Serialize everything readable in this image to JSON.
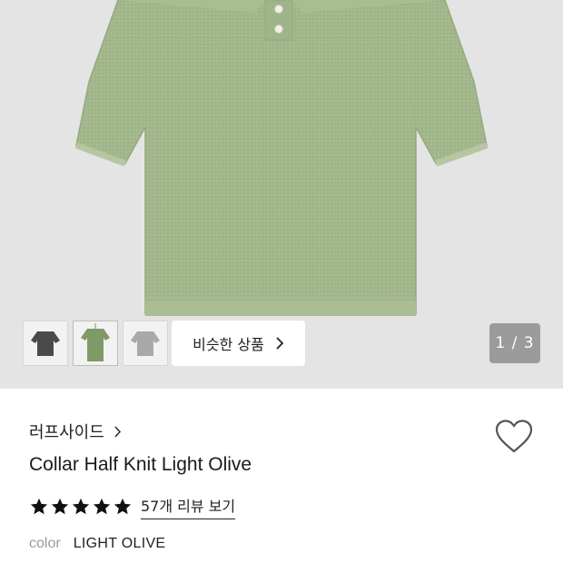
{
  "gallery": {
    "thumbnails": [
      {
        "alt": "charcoal",
        "color": "#4a4a4a"
      },
      {
        "alt": "light olive",
        "color": "#7f9a67"
      },
      {
        "alt": "gray",
        "color": "#a8aaa8"
      }
    ],
    "similar_label": "비슷한 상품",
    "counter": "1 / 3",
    "product_color": "#a4b98d"
  },
  "product": {
    "brand": "러프사이드",
    "title": "Collar Half Knit Light Olive",
    "rating_stars": 5,
    "reviews_label": "57개 리뷰 보기",
    "color_label": "color",
    "color_value": "LIGHT OLIVE"
  }
}
